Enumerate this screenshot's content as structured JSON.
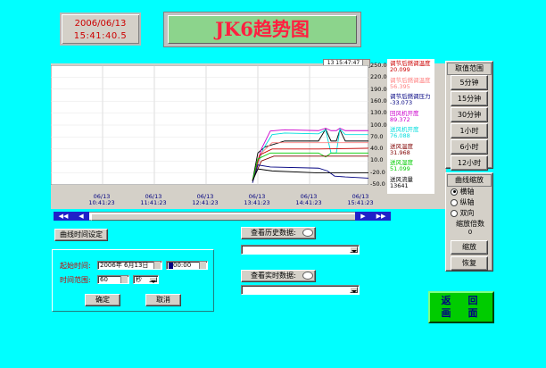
{
  "clock": {
    "date": "2006/06/13",
    "time": "15:41:40.5"
  },
  "title": "JK6趋势图",
  "chart": {
    "timestamp_label": "13 15:47:47",
    "y_ticks": [
      "250.0",
      "220.0",
      "190.0",
      "160.0",
      "130.0",
      "100.0",
      "70.0",
      "40.0",
      "10.0",
      "-20.0",
      "-50.0"
    ],
    "x_ticks": [
      {
        "date": "06/13",
        "time": "10:41:23"
      },
      {
        "date": "06/13",
        "time": "11:41:23"
      },
      {
        "date": "06/13",
        "time": "12:41:23"
      },
      {
        "date": "06/13",
        "time": "13:41:23"
      },
      {
        "date": "06/13",
        "time": "14:41:23"
      },
      {
        "date": "06/13",
        "time": "15:41:23"
      }
    ],
    "legend": [
      {
        "name": "调节后燃调温度",
        "value": "20.099",
        "color": "#cc0000"
      },
      {
        "name": "调节后燃调温度",
        "value": "56.395",
        "color": "#ff8080"
      },
      {
        "name": "调节后燃调压力",
        "value": "-33.073",
        "color": "#000080"
      },
      {
        "name": "回风机开度",
        "value": "89.372",
        "color": "#cc00cc"
      },
      {
        "name": "送风机开度",
        "value": "76.088",
        "color": "#00dddd"
      },
      {
        "name": "送风温度",
        "value": "31.968",
        "color": "#800000"
      },
      {
        "name": "送风湿度",
        "value": "51.099",
        "color": "#00cc00"
      },
      {
        "name": "送风流量",
        "value": "13641",
        "color": "#000000"
      }
    ]
  },
  "range_panel": {
    "title": "取值范围",
    "buttons": [
      "5分钟",
      "15分钟",
      "30分钟",
      "1小时",
      "6小时",
      "12小时"
    ]
  },
  "zoom_panel": {
    "title": "曲线缩放",
    "options": [
      "横轴",
      "纵轴",
      "双向"
    ],
    "selected": "横轴",
    "factor_label": "缩放倍数",
    "factor_value": "0",
    "zoom_button": "缩放",
    "restore_button": "恢复"
  },
  "time_setting": {
    "button": "曲线时间设定",
    "start_label": "起始时间:",
    "start_date": "2006年 6月13日",
    "start_time": "00:00",
    "range_label": "时间范围:",
    "range_value": "60",
    "range_unit": "秒",
    "ok": "确定",
    "cancel": "取消"
  },
  "history": {
    "label": "查看历史数据:"
  },
  "realtime": {
    "label": "查看实时数据:"
  },
  "return_button": {
    "line1": "返　回",
    "line2": "画　面"
  },
  "colors": {
    "bg": "#00ffff",
    "title_bg": "#8cd48c",
    "title_text": "#ff2040",
    "clock_bg": "#d4d0c8",
    "clock_text": "#cc0000",
    "return_bg": "#00cc00",
    "return_text": "#000080"
  }
}
